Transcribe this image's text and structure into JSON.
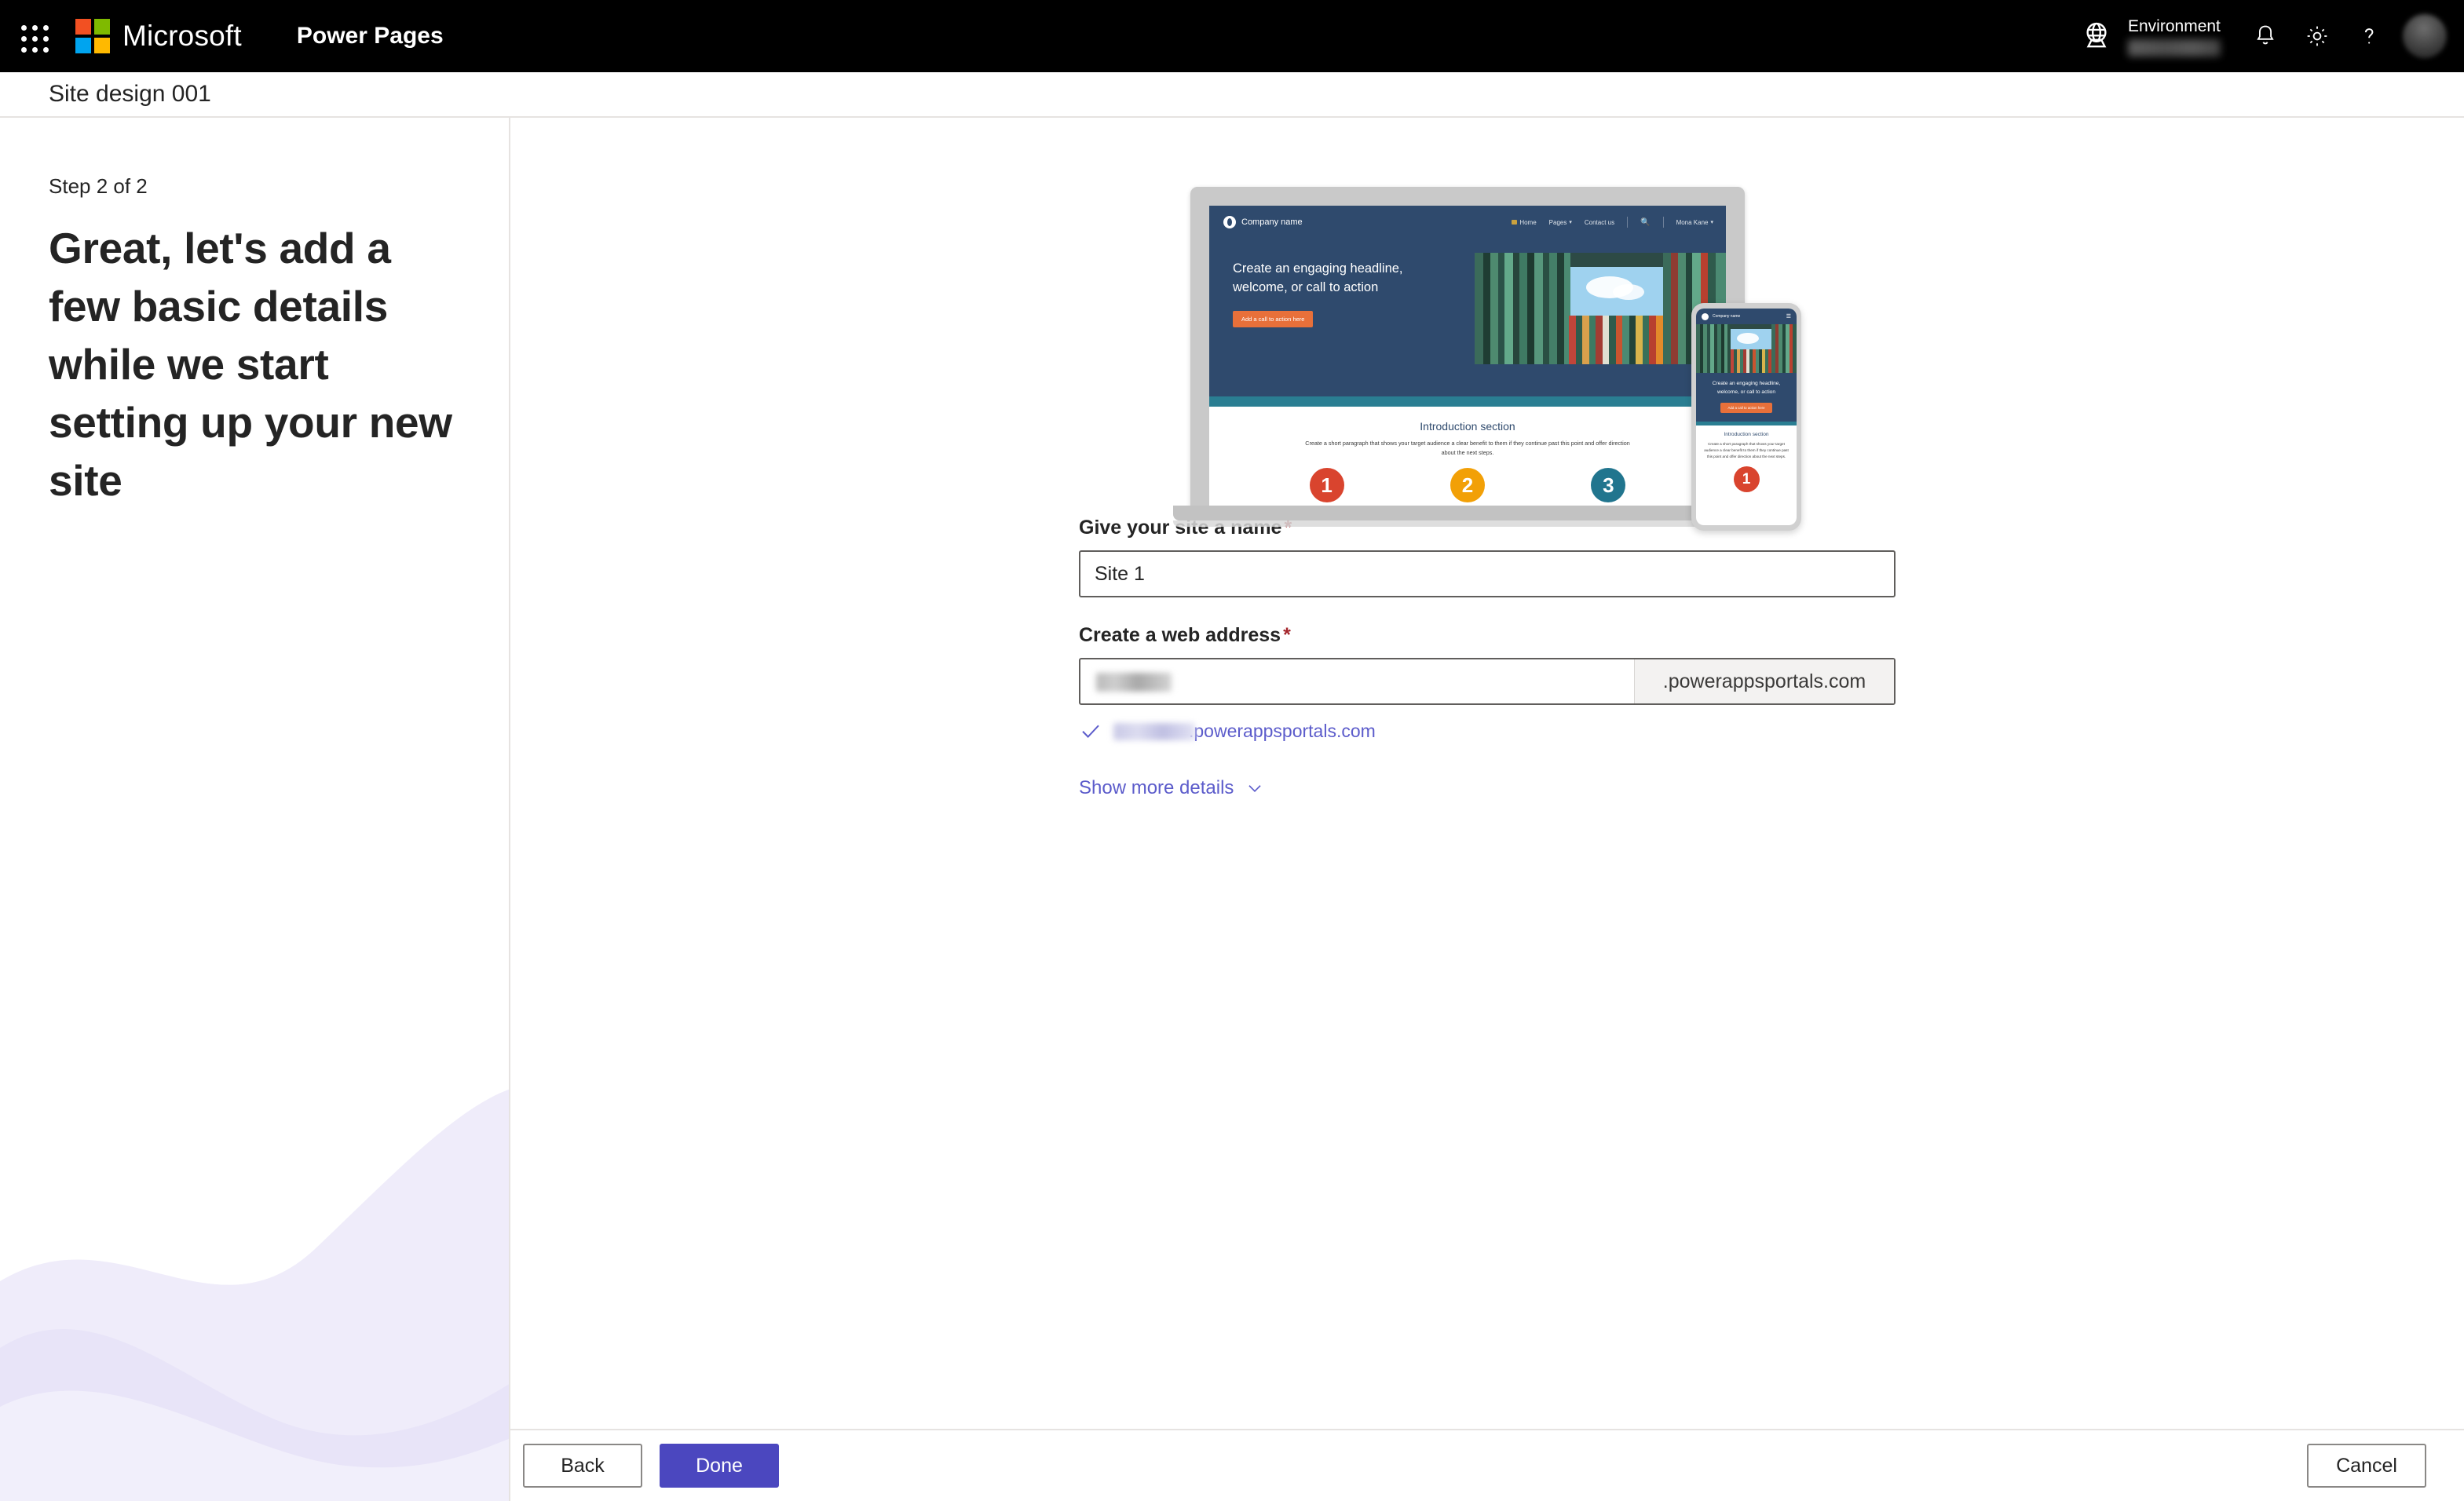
{
  "suite": {
    "brand": "Microsoft",
    "app_name": "Power Pages",
    "environment_label": "Environment",
    "waffle_name": "app-launcher",
    "icons": {
      "globe": "globe-icon",
      "notifications": "bell-icon",
      "settings": "gear-icon",
      "help": "question-mark-icon",
      "account": "account-avatar"
    }
  },
  "page": {
    "title": "Site design 001"
  },
  "left_panel": {
    "step": "Step 2 of 2",
    "headline": "Great, let's add a few basic details while we start setting up your new site"
  },
  "preview": {
    "site": {
      "company_name": "Company name",
      "nav": [
        "Home",
        "Pages",
        "Contact us",
        "Mona Kane"
      ],
      "hero_headline": "Create an engaging headline, welcome, or call to action",
      "hero_cta": "Add a call to action here",
      "intro_title": "Introduction section",
      "intro_copy": "Create a short paragraph that shows your target audience a clear benefit to them if they continue past this point and offer direction about the next steps.",
      "numbers": [
        "1",
        "2",
        "3"
      ],
      "colors": {
        "hero_bg": "#2f4a6d",
        "band": "#2a7e92",
        "cta": "#e8703a",
        "circle_1": "#d9442e",
        "circle_2": "#f2a007",
        "circle_3": "#21758e"
      }
    },
    "phone": {
      "company_name": "Company name",
      "hero_headline": "Create an engaging headline, welcome, or call to action",
      "hero_cta": "Add a call to action here",
      "intro_title": "Introduction section",
      "intro_copy": "Create a short paragraph that shows your target audience a clear benefit to them if they continue past this point and offer direction about the next steps.",
      "number": "1"
    }
  },
  "form": {
    "name_field": {
      "label": "Give your site a name",
      "required_mark": "*",
      "value": "Site 1",
      "placeholder": "Site 1"
    },
    "address_field": {
      "label": "Create a web address",
      "required_mark": "*",
      "value": "",
      "placeholder": "",
      "suffix": ".powerappsportals.com"
    },
    "validation": {
      "suffix_text": ".powerappsportals.com"
    },
    "show_more": "Show more details"
  },
  "footer": {
    "back": "Back",
    "done": "Done",
    "cancel": "Cancel"
  },
  "colors": {
    "accent": "#4b47bf",
    "link": "#5c5ccb",
    "required": "#a4262c"
  }
}
